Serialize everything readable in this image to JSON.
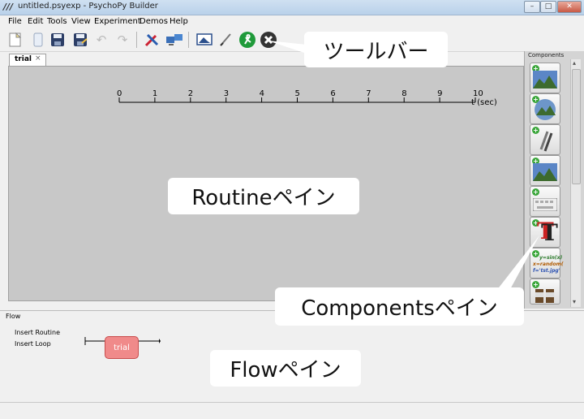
{
  "window": {
    "title": "untitled.psyexp - PsychoPy Builder",
    "app_icon": "psychopy-icon"
  },
  "menu": [
    "File",
    "Edit",
    "Tools",
    "View",
    "Experiment",
    "Demos",
    "Help"
  ],
  "toolbar_icons": [
    "new-file-icon",
    "open-file-icon",
    "save-icon",
    "save-as-icon",
    "undo-icon",
    "redo-icon",
    "preferences-icon",
    "monitor-center-icon",
    "experiment-settings-icon",
    "compile-script-icon",
    "run-icon",
    "stop-icon"
  ],
  "routine": {
    "tab_label": "trial",
    "tab_close": "×",
    "timeline_ticks": [
      "0",
      "1",
      "2",
      "3",
      "4",
      "5",
      "6",
      "7",
      "8",
      "9",
      "10"
    ],
    "timeline_unit": "t (sec)"
  },
  "components": {
    "title": "Components",
    "items": [
      "image-component-icon",
      "movie-component-icon",
      "grating-component-icon",
      "patch-component-icon",
      "keyboard-component-icon",
      "text-component-icon",
      "code-component-icon",
      "other-component-icon"
    ],
    "code_snippet": [
      "y=sin(x)",
      "x=random(",
      "f='tst.jpg'"
    ]
  },
  "flow": {
    "title": "Flow",
    "insert_routine": "Insert Routine",
    "insert_loop": "Insert Loop",
    "routine_box": "trial"
  },
  "annotations": {
    "toolbar": "ツールバー",
    "routine": "Routineペイン",
    "components": "Componentsペイン",
    "flow": "Flowペイン"
  }
}
